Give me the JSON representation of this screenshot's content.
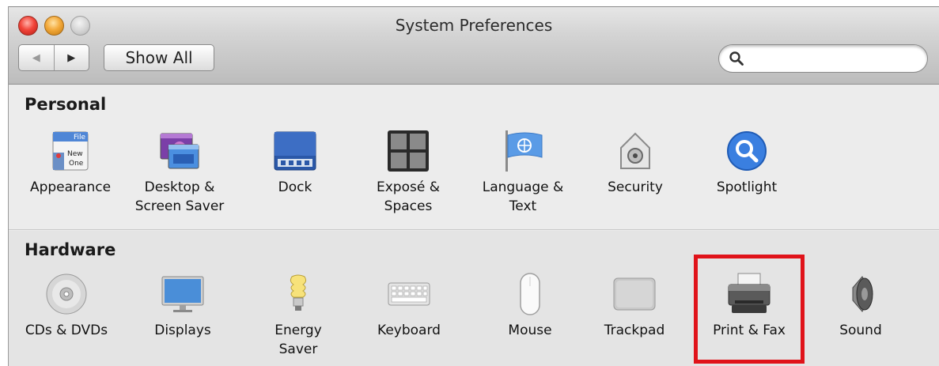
{
  "window": {
    "title": "System Preferences"
  },
  "toolbar": {
    "back_glyph": "◀",
    "forward_glyph": "▶",
    "show_all_label": "Show All",
    "search_value": "",
    "search_icon": "search-icon"
  },
  "personal": {
    "title": "Personal",
    "items": [
      {
        "label": "Appearance",
        "icon": "appearance-icon"
      },
      {
        "label": "Desktop &\nScreen Saver",
        "icon": "desktop-screen-saver-icon"
      },
      {
        "label": "Dock",
        "icon": "dock-icon"
      },
      {
        "label": "Exposé &\nSpaces",
        "icon": "expose-spaces-icon"
      },
      {
        "label": "Language &\nText",
        "icon": "language-text-icon"
      },
      {
        "label": "Security",
        "icon": "security-icon"
      },
      {
        "label": "Spotlight",
        "icon": "spotlight-icon"
      }
    ],
    "appearance_icon_text": {
      "file": "File",
      "new": "New",
      "one": "One"
    }
  },
  "hardware": {
    "title": "Hardware",
    "items": [
      {
        "label": "CDs & DVDs",
        "icon": "cd-dvd-icon"
      },
      {
        "label": "Displays",
        "icon": "displays-icon"
      },
      {
        "label": "Energy\nSaver",
        "icon": "energy-saver-icon"
      },
      {
        "label": "Keyboard",
        "icon": "keyboard-icon"
      },
      {
        "label": "Mouse",
        "icon": "mouse-icon"
      },
      {
        "label": "Trackpad",
        "icon": "trackpad-icon"
      },
      {
        "label": "Print & Fax",
        "icon": "print-fax-icon"
      },
      {
        "label": "Sound",
        "icon": "sound-icon"
      }
    ]
  },
  "colors": {
    "highlight_box": "#e0131a",
    "close": "#f2453a",
    "minimize": "#f3a93a",
    "zoom": "#d0d0d0"
  }
}
